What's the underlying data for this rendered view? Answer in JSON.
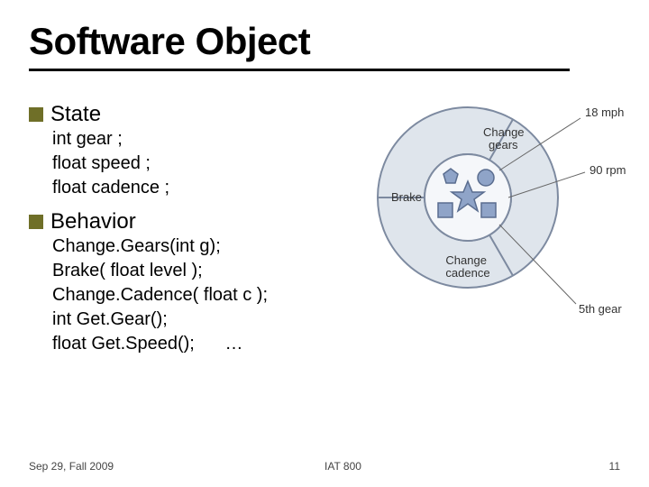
{
  "title": "Software Object",
  "sections": {
    "state": {
      "heading": "State",
      "lines": [
        "int gear ;",
        "float speed ;",
        "float cadence ;"
      ]
    },
    "behavior": {
      "heading": "Behavior",
      "lines": [
        "Change.Gears(int g);",
        "Brake( float level );",
        "Change.Cadence( float c );",
        "int Get.Gear();",
        "float Get.Speed();"
      ],
      "ellipsis": "…"
    }
  },
  "diagram": {
    "wedges": {
      "top": "Change gears",
      "left": "Brake",
      "bottom": "Change cadence"
    },
    "callouts": {
      "line1": "18 mph",
      "line2": "90 rpm",
      "line3": "5th gear"
    }
  },
  "footer": {
    "date": "Sep 29, Fall 2009",
    "course": "IAT 800",
    "page": "11"
  }
}
